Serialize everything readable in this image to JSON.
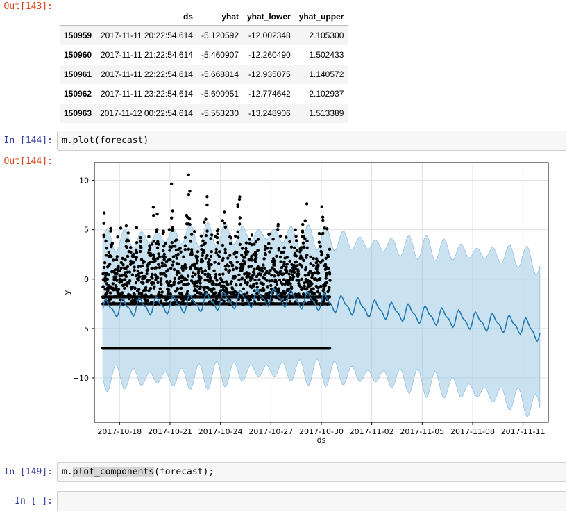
{
  "cells": {
    "out143": {
      "prompt": "Out[143]:"
    },
    "in144": {
      "prompt": "In [144]:",
      "code": "m.plot(forecast)"
    },
    "out144": {
      "prompt": "Out[144]:"
    },
    "in149": {
      "prompt": "In [149]:",
      "code_pre": "m.",
      "code_hl": "plot_components",
      "code_post": "(forecast);"
    },
    "in_empty": {
      "prompt": "In [ ]:",
      "code": ""
    }
  },
  "dataframe": {
    "columns": [
      "",
      "ds",
      "yhat",
      "yhat_lower",
      "yhat_upper"
    ],
    "rows": [
      [
        "150959",
        "2017-11-11 20:22:54.614",
        "-5.120592",
        "-12.002348",
        "2.105300"
      ],
      [
        "150960",
        "2017-11-11 21:22:54.614",
        "-5.460907",
        "-12.260490",
        "1.502433"
      ],
      [
        "150961",
        "2017-11-11 22:22:54.614",
        "-5.668814",
        "-12.935075",
        "1.140572"
      ],
      [
        "150962",
        "2017-11-11 23:22:54.614",
        "-5.690951",
        "-12.774642",
        "2.102937"
      ],
      [
        "150963",
        "2017-11-12 00:22:54.614",
        "-5.553230",
        "-13.248906",
        "1.513389"
      ]
    ]
  },
  "chart_data": {
    "type": "line",
    "xlabel": "ds",
    "ylabel": "y",
    "x_tick_labels": [
      "2017-10-18",
      "2017-10-21",
      "2017-10-24",
      "2017-10-27",
      "2017-10-30",
      "2017-11-02",
      "2017-11-05",
      "2017-11-08",
      "2017-11-11"
    ],
    "y_tick_labels": [
      "10",
      "5",
      "0",
      "−5",
      "−10"
    ],
    "y_ticks": [
      10,
      5,
      0,
      -5,
      -10
    ],
    "xlim": [
      "2017-10-16T12:00",
      "2017-11-12T12:00"
    ],
    "ylim": [
      -14.5,
      11.8
    ],
    "grid": true,
    "series": [
      {
        "kind": "observed points",
        "color": "#000000",
        "x_range": [
          "2017-10-17",
          "2017-10-30T12:00"
        ],
        "y_range": [
          -7,
          10.7
        ]
      },
      {
        "kind": "forecast yhat",
        "color": "#1f77b4",
        "x": [
          "2017-10-17",
          "2017-10-22",
          "2017-10-27",
          "2017-10-30",
          "2017-11-02",
          "2017-11-05",
          "2017-11-08",
          "2017-11-11",
          "2017-11-12"
        ],
        "y": [
          -3.0,
          -2.5,
          -1.8,
          -2.3,
          -3.0,
          -3.6,
          -4.2,
          -4.7,
          -5.5
        ]
      },
      {
        "kind": "uncertainty interval",
        "color": "#9ecae1",
        "x": [
          "2017-10-17",
          "2017-10-22",
          "2017-10-27",
          "2017-10-30",
          "2017-11-02",
          "2017-11-05",
          "2017-11-08",
          "2017-11-11",
          "2017-11-12"
        ],
        "y_lower": [
          -10,
          -10,
          -9.2,
          -9.5,
          -9.8,
          -10.5,
          -11.3,
          -12.4,
          -13.2
        ],
        "y_upper": [
          3.8,
          4.5,
          4.5,
          4.2,
          3.5,
          3.2,
          2.7,
          2.3,
          1.5
        ]
      }
    ]
  }
}
